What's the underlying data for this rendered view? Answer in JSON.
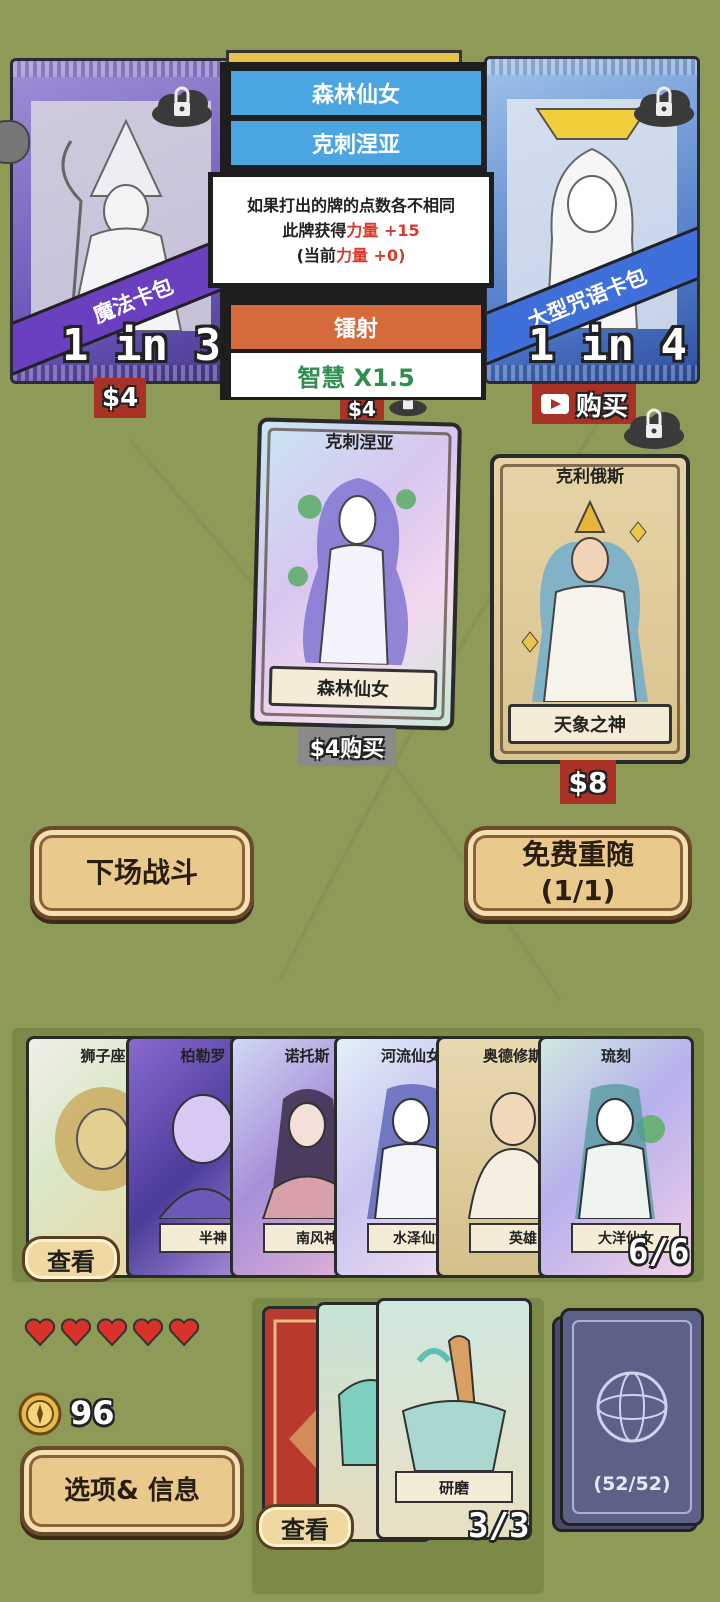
{
  "packs": {
    "left": {
      "banner": "魔法卡包",
      "odds": "1 in 3",
      "price": "$4"
    },
    "right": {
      "banner": "大型咒语卡包",
      "odds": "1 in 4",
      "price": "购买"
    },
    "middle_price_partial": "$4"
  },
  "tooltip": {
    "name": "森林仙女",
    "subtitle": "克刺涅亚",
    "desc_line1": "如果打出的牌的点数各不相同",
    "desc_line2_pre": "此牌获得",
    "desc_line2_stat": "力量",
    "desc_line2_val": " +15",
    "desc_line3_pre": "(当前",
    "desc_line3_stat": "力量",
    "desc_line3_val": " +0)",
    "tag1": "镭射",
    "tag2": "智慧 X1.5"
  },
  "shop_cards": [
    {
      "top": "克刺涅亚",
      "ribbon": "森林仙女",
      "price": "$4购买"
    },
    {
      "top": "克利俄斯",
      "ribbon": "天象之神",
      "price": "$8"
    }
  ],
  "buttons": {
    "fight": "下场战斗",
    "reroll_line1": "免费重随",
    "reroll_line2": "(1/1)",
    "options": "选项& 信息",
    "view": "查看"
  },
  "hand": {
    "count": "6/6",
    "cards": [
      {
        "title": "狮子座",
        "ribbon": ""
      },
      {
        "title": "柏勒罗",
        "ribbon": "半神"
      },
      {
        "title": "诺托斯",
        "ribbon": "南风神"
      },
      {
        "title": "河流仙女",
        "ribbon": "水泽仙女"
      },
      {
        "title": "奥德修斯",
        "ribbon": "英雄"
      },
      {
        "title": "琉刻",
        "ribbon": "大洋仙女"
      }
    ]
  },
  "lives": 5,
  "gold": "96",
  "consumables": {
    "count": "3/3",
    "ribbon": "研磨"
  },
  "deck": {
    "count": "(52/52)"
  },
  "colors": {
    "bg": "#8e9a58",
    "tag_blue": "#4aa5e0",
    "tag_orange": "#d66a3a",
    "tag_green": "#2f8f4e",
    "price_red": "#a93226"
  }
}
